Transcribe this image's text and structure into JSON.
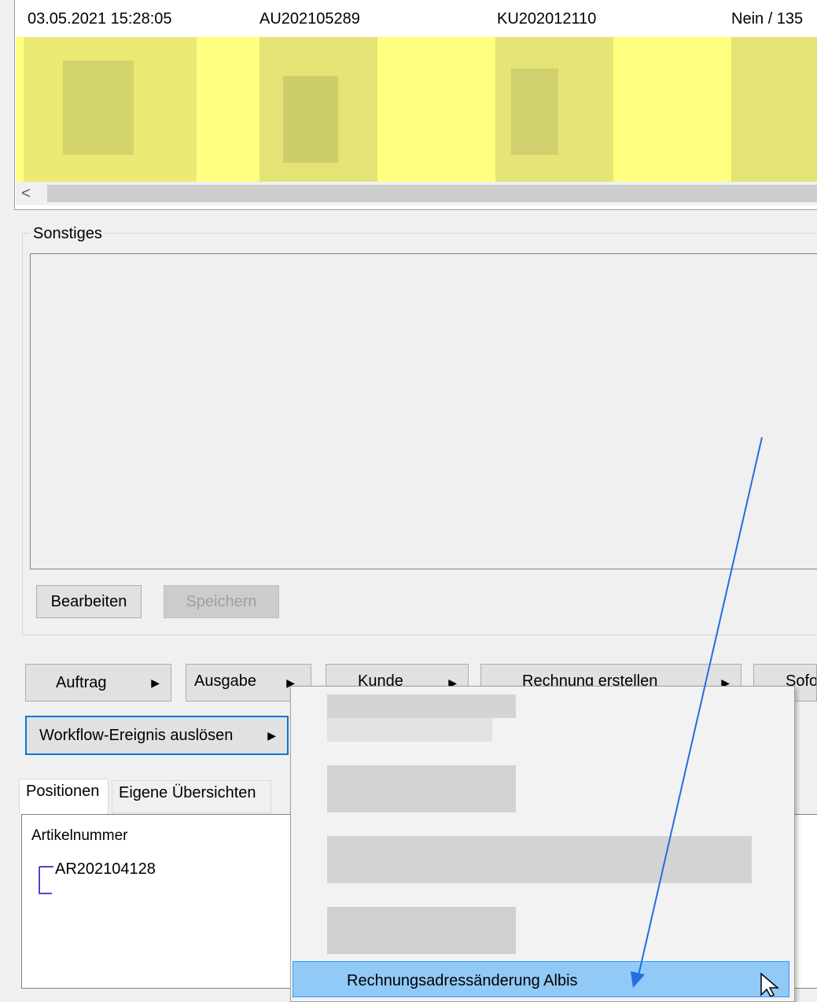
{
  "grid": {
    "row": {
      "date": "03.05.2021 15:28:05",
      "order_no": "AU202105289",
      "customer_no": "KU202012110",
      "status": "Nein / 135"
    },
    "scroll_left_glyph": "<"
  },
  "sonstiges": {
    "title": "Sonstiges",
    "edit_label": "Bearbeiten",
    "save_label": "Speichern"
  },
  "actions": {
    "auftrag": "Auftrag",
    "ausgabe": "Ausgabe",
    "kunde": "Kunde",
    "rechnung": "Rechnung erstellen",
    "sofort": "Sofo",
    "workflow": "Workflow-Ereignis auslösen"
  },
  "tabs": {
    "positionen": "Positionen",
    "eigene": "Eigene Übersichten"
  },
  "positions": {
    "column_header": "Artikelnummer",
    "items": [
      "AR202104128"
    ]
  },
  "context_menu": {
    "highlighted_item": "Rechnungsadressänderung Albis"
  },
  "colors": {
    "highlight_yellow": "#ffff80",
    "menu_highlight": "#91c9f7",
    "focus_blue": "#0078d7",
    "annotation_arrow": "#1f6fe0"
  }
}
